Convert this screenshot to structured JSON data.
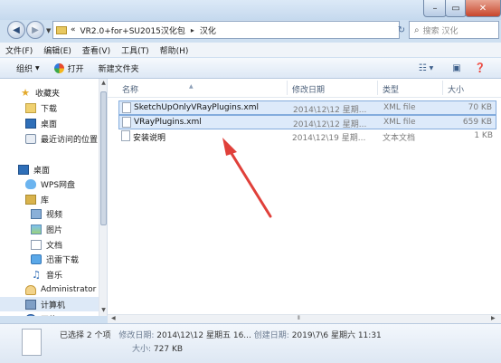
{
  "window": {
    "controls": {
      "minimize": "–",
      "maximize": "▭",
      "close": "✕"
    }
  },
  "address": {
    "prefix": "«",
    "crumbs": [
      "VR2.0+for+SU2015汉化包",
      "汉化"
    ],
    "separator": "▸",
    "search_placeholder": "搜索 汉化"
  },
  "menu": [
    "文件(F)",
    "编辑(E)",
    "查看(V)",
    "工具(T)",
    "帮助(H)"
  ],
  "toolbar": {
    "organize": "组织",
    "open": "打开",
    "new_folder": "新建文件夹"
  },
  "sidebar": {
    "items": [
      {
        "label": "收藏夹",
        "icon": "star-icon"
      },
      {
        "label": "下载",
        "icon": "folder-icon"
      },
      {
        "label": "桌面",
        "icon": "desktop-icon"
      },
      {
        "label": "最近访问的位置",
        "icon": "recent-places-icon"
      },
      {
        "label": "桌面",
        "icon": "desktop-icon"
      },
      {
        "label": "WPS网盘",
        "icon": "cloud-icon"
      },
      {
        "label": "库",
        "icon": "library-icon"
      },
      {
        "label": "视频",
        "icon": "video-icon"
      },
      {
        "label": "图片",
        "icon": "picture-icon"
      },
      {
        "label": "文档",
        "icon": "document-icon"
      },
      {
        "label": "迅雷下载",
        "icon": "xunlei-icon"
      },
      {
        "label": "音乐",
        "icon": "music-icon"
      },
      {
        "label": "Administrator",
        "icon": "user-icon"
      },
      {
        "label": "计算机",
        "icon": "computer-icon"
      },
      {
        "label": "网络",
        "icon": "network-icon"
      }
    ]
  },
  "columns": {
    "name": "名称",
    "date": "修改日期",
    "type": "类型",
    "size": "大小"
  },
  "files": [
    {
      "name": "SketchUpOnlyVRayPlugins.xml",
      "date": "2014\\12\\12 星期...",
      "type": "XML file",
      "size": "70 KB",
      "selected": true
    },
    {
      "name": "VRayPlugins.xml",
      "date": "2014\\12\\12 星期...",
      "type": "XML file",
      "size": "659 KB",
      "selected": true
    },
    {
      "name": "安装说明",
      "date": "2014\\12\\19 星期...",
      "type": "文本文档",
      "size": "1 KB",
      "selected": false
    }
  ],
  "details": {
    "selected_count": "已选择 2 个项",
    "modified_label": "修改日期:",
    "modified_value": "2014\\12\\12 星期五 16...",
    "created_label": "创建日期:",
    "created_value": "2019\\7\\6 星期六 11:31",
    "size_label": "大小:",
    "size_value": "727 KB"
  },
  "colors": {
    "annotation_arrow": "#e0403a",
    "selection_fill": "#ddeafa",
    "selection_border": "#84acdd"
  }
}
